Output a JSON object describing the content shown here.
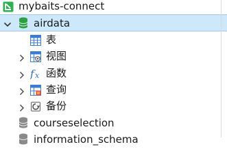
{
  "tree": {
    "connection": {
      "label": "mybaits-connect",
      "icon": "connection-icon"
    },
    "database": {
      "label": "airdata",
      "icon": "database-icon",
      "expanded": true,
      "selected": true
    },
    "children": [
      {
        "label": "表",
        "icon": "table-icon"
      },
      {
        "label": "视图",
        "icon": "view-icon"
      },
      {
        "label": "函数",
        "icon": "function-icon"
      },
      {
        "label": "查询",
        "icon": "query-icon"
      },
      {
        "label": "备份",
        "icon": "backup-icon"
      }
    ],
    "other_databases": [
      {
        "label": "courseselection",
        "icon": "database-icon"
      },
      {
        "label": "information_schema",
        "icon": "database-icon"
      }
    ]
  },
  "colors": {
    "selection_bg": "#cde8fb",
    "selection_border": "#9cc9ec",
    "connection_green": "#2bb24c",
    "database_green": "#2f9e44",
    "database_grey": "#8a8a8a",
    "function_blue": "#2f6fc4"
  }
}
